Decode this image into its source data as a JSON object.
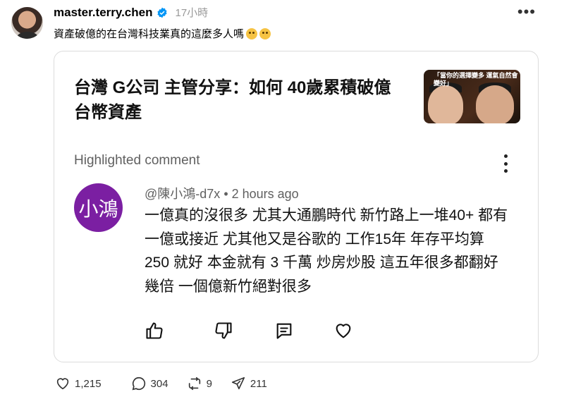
{
  "post": {
    "username": "master.terry.chen",
    "time": "17小時",
    "caption": "資產破億的在台灣科技業真的這麼多人嗎",
    "more_icon": "more-horizontal-icon"
  },
  "card": {
    "title": "台灣 G公司 主管分享：如何 40歲累積破億台幣資產",
    "thumbnail_text": "「當你的選擇變多 運氣自然會變好」",
    "highlighted_label": "Highlighted comment",
    "comment": {
      "avatar_text": "小鴻",
      "author": "@陳小鴻-d7x",
      "time": "2 hours ago",
      "text": "一億真的沒很多 尤其大通鵬時代  新竹路上一堆40+ 都有一億或接近 尤其他又是谷歌的 工作15年 年存平均算 250 就好 本金就有 3 千萬 炒房炒股 這五年很多都翻好幾倍 一個億新竹絕對很多"
    }
  },
  "stats": {
    "likes": "1,215",
    "replies": "304",
    "reposts": "9",
    "shares": "211"
  },
  "colors": {
    "comment_avatar_bg": "#7b1fa2",
    "verified_blue": "#0095f6",
    "muted_text": "#999999"
  }
}
